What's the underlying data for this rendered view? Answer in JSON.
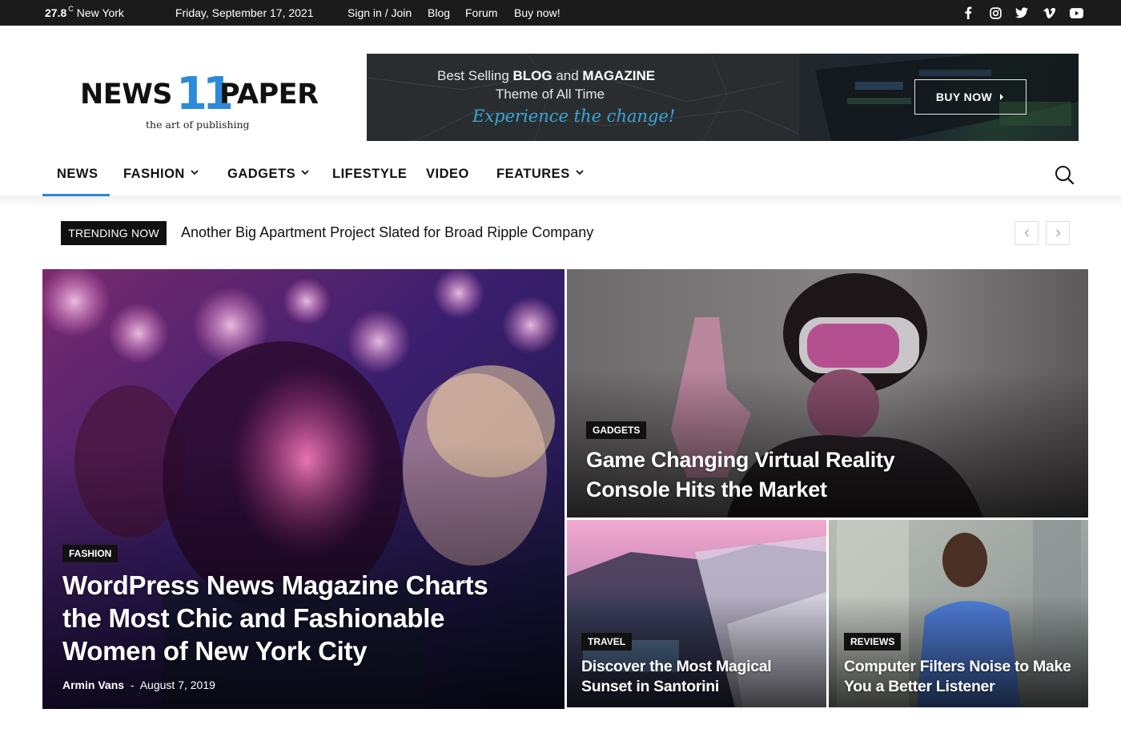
{
  "topbar": {
    "temperature": "27.8",
    "temperature_unit": "C",
    "city": "New York",
    "date": "Friday, September 17, 2021",
    "links": [
      "Sign in / Join",
      "Blog",
      "Forum",
      "Buy now!"
    ],
    "social": [
      "facebook-icon",
      "instagram-icon",
      "twitter-icon",
      "vimeo-icon",
      "youtube-icon"
    ]
  },
  "logo": {
    "left": "NEWS",
    "number": "11",
    "right": "PAPER",
    "tagline": "the art of publishing"
  },
  "banner": {
    "line1_pre": "Best Selling ",
    "line1_b1": "BLOG",
    "line1_mid": " and ",
    "line1_b2": "MAGAZINE",
    "line2": "Theme of All Time",
    "line3": "Experience the change!",
    "button": "BUY NOW"
  },
  "nav": {
    "items": [
      "NEWS",
      "FASHION",
      "GADGETS",
      "LIFESTYLE",
      "VIDEO",
      "FEATURES"
    ]
  },
  "trending": {
    "label": "TRENDING NOW",
    "headline": "Another Big Apartment Project Slated for Broad Ripple Company"
  },
  "posts": {
    "main": {
      "category": "FASHION",
      "title_lines": [
        "WordPress News Magazine Charts",
        "the Most Chic and Fashionable",
        "Women of New York City"
      ],
      "author": "Armin Vans",
      "separator": "-",
      "date": "August 7, 2019"
    },
    "top_right": {
      "category": "GADGETS",
      "title_lines": [
        "Game Changing Virtual Reality",
        "Console Hits the Market"
      ]
    },
    "bottom_left": {
      "category": "TRAVEL",
      "title_lines": [
        "Discover the Most Magical",
        "Sunset in Santorini"
      ]
    },
    "bottom_right": {
      "category": "REVIEWS",
      "title_lines": [
        "Computer Filters Noise to Make",
        "You a Better Listener"
      ]
    }
  },
  "colors": {
    "accent": "#2c8ad8",
    "topbar": "#1b1b1b",
    "label_bg": "#111111"
  }
}
